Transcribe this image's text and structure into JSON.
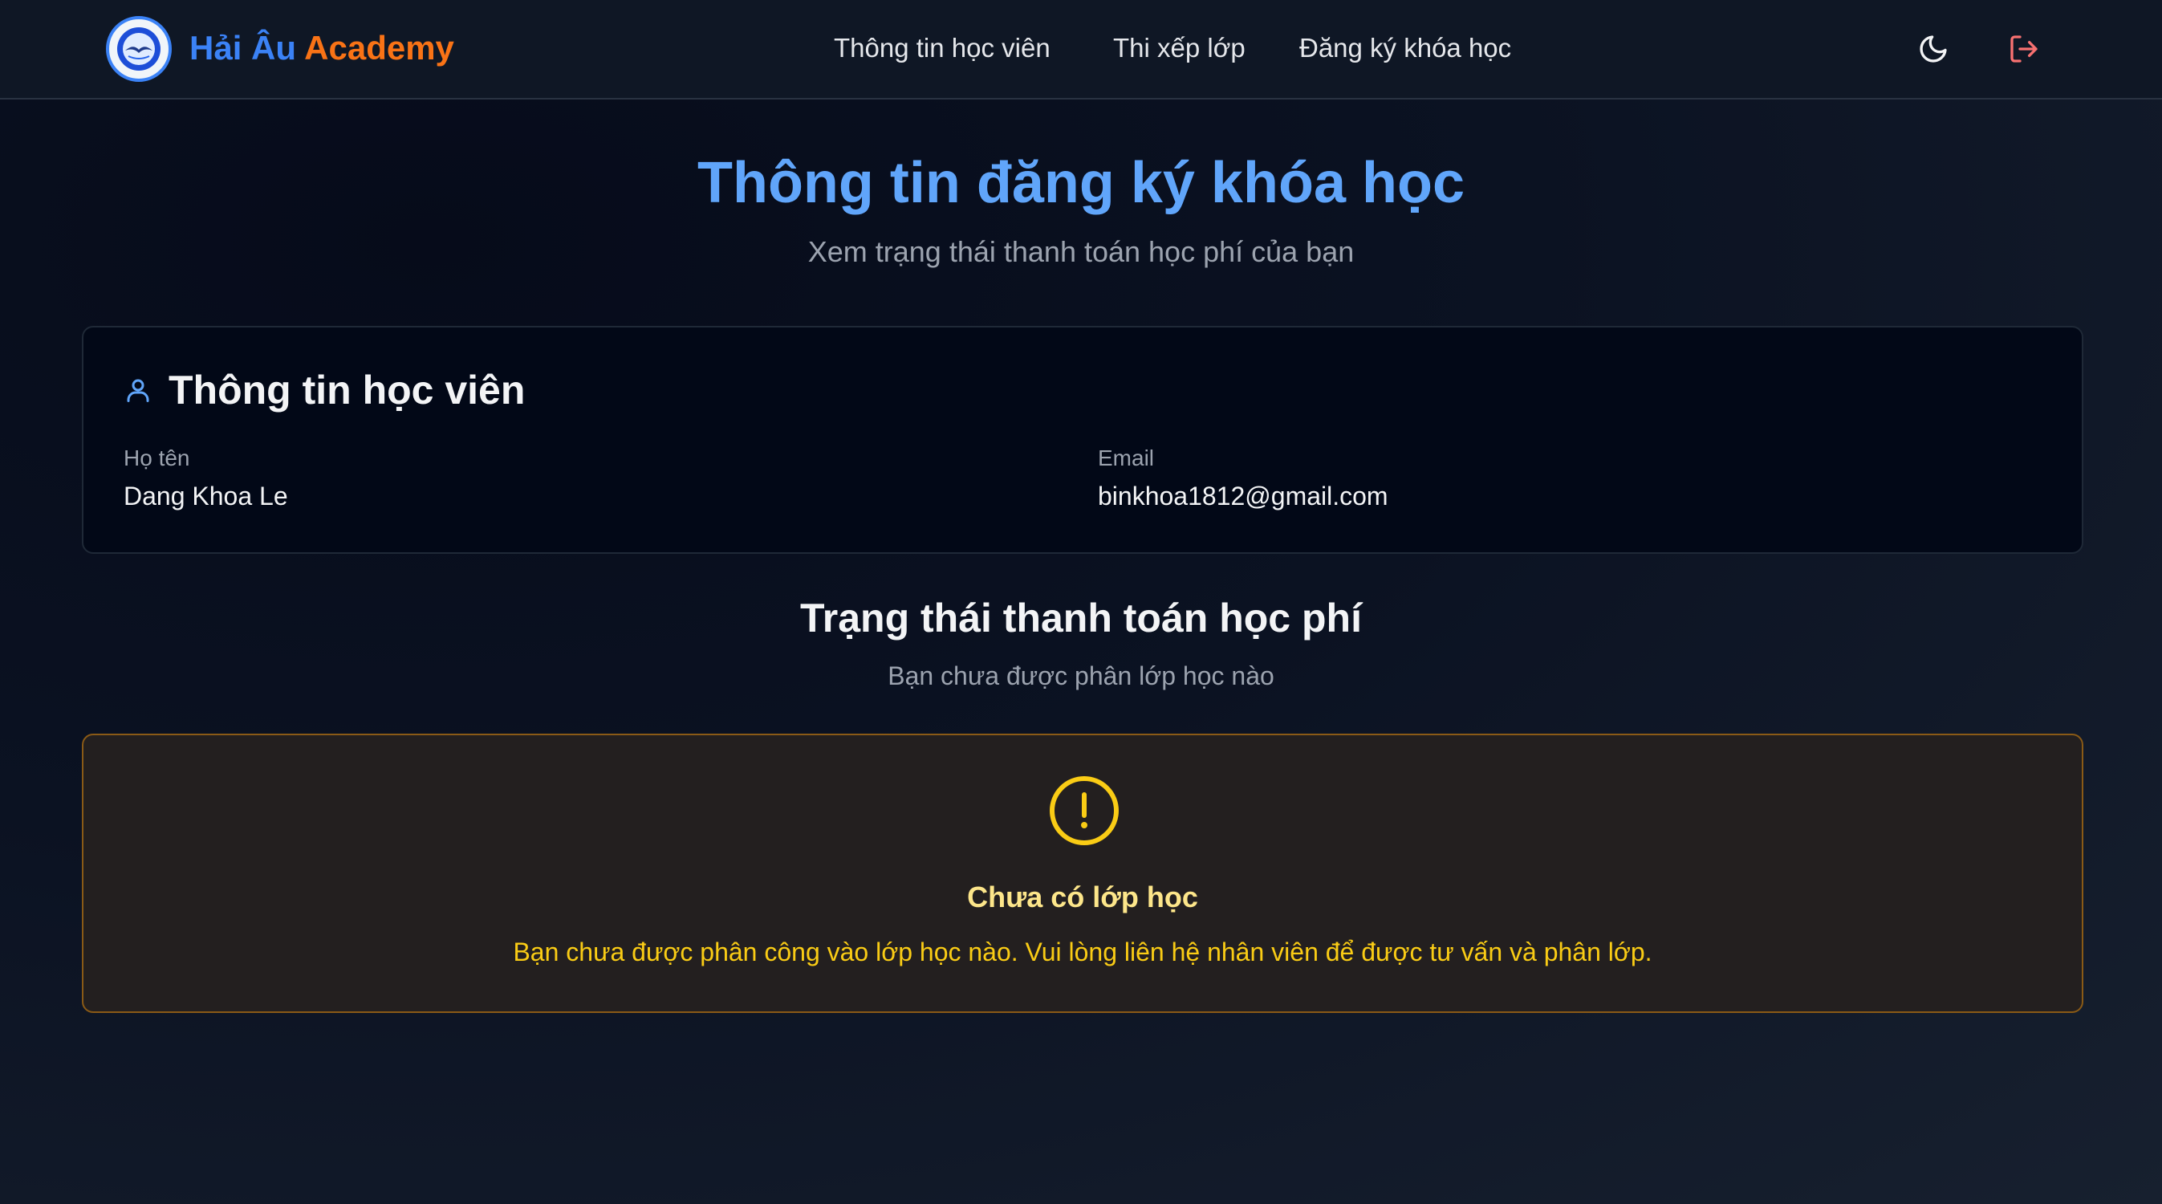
{
  "header": {
    "brand_part1": "Hải Âu",
    "brand_part2": "Academy",
    "nav": [
      {
        "label": "Thông tin học viên"
      },
      {
        "label": "Thi xếp lớp"
      },
      {
        "label": "Đăng ký khóa học"
      }
    ],
    "icons": {
      "logo": "seagull-logo",
      "theme": "moon-icon",
      "logout": "logout-icon"
    }
  },
  "page": {
    "title": "Thông tin đăng ký khóa học",
    "subtitle": "Xem trạng thái thanh toán học phí của bạn"
  },
  "student": {
    "title": "Thông tin học viên",
    "name_label": "Họ tên",
    "name_value": "Dang Khoa Le",
    "email_label": "Email",
    "email_value": "binkhoa1812@gmail.com"
  },
  "payment": {
    "title": "Trạng thái thanh toán học phí",
    "subtitle": "Bạn chưa được phân lớp học nào"
  },
  "warning": {
    "title": "Chưa có lớp học",
    "message": "Bạn chưa được phân công vào lớp học nào. Vui lòng liên hệ nhân viên để được tư vấn và phân lớp."
  },
  "colors": {
    "accent": "#60a5fa",
    "brand_orange": "#f97316",
    "warning": "#facc15",
    "logout": "#f87171"
  }
}
